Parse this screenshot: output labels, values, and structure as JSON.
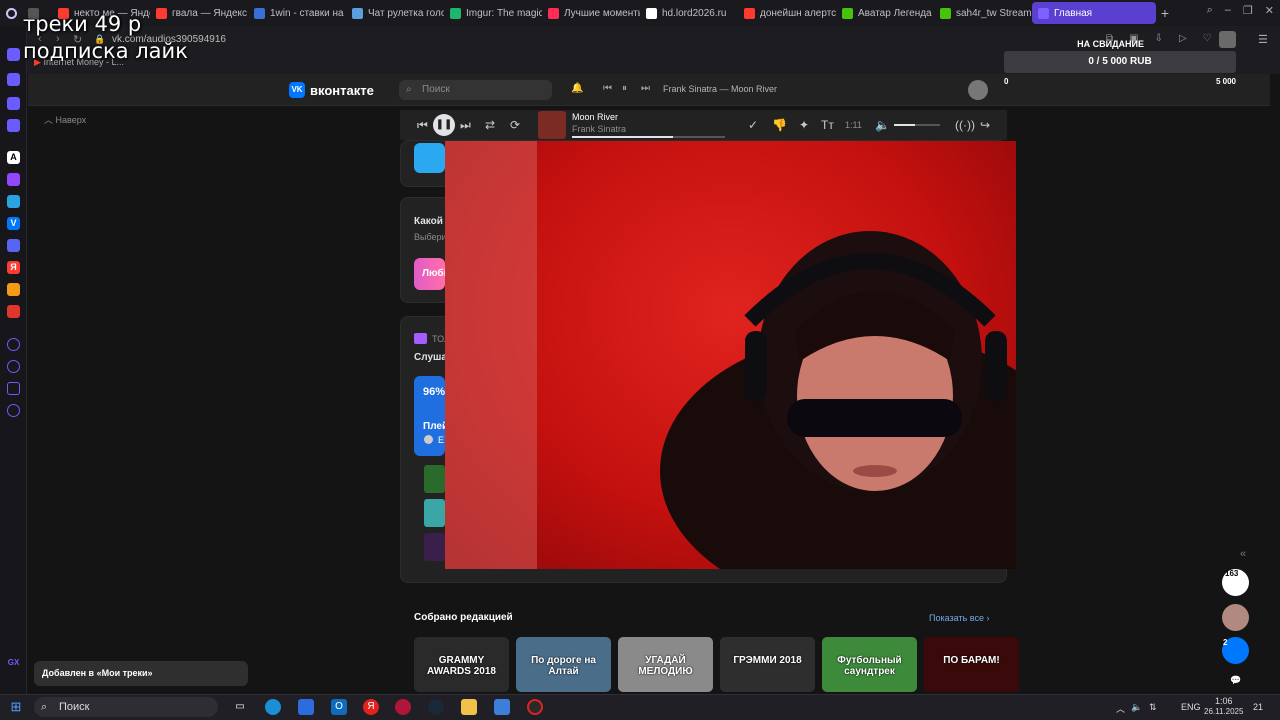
{
  "browser": {
    "tabs": [
      {
        "label": "некто ме — Янде",
        "color": "#ff3b30"
      },
      {
        "label": "гвала — Яндекс",
        "color": "#ff3b30"
      },
      {
        "label": "1win - ставки на",
        "color": "#3a6fd8"
      },
      {
        "label": "Чат рулетка голо",
        "color": "#5aa0e0"
      },
      {
        "label": "Imgur: The magic",
        "color": "#1bb76e"
      },
      {
        "label": "Лучшие моменты",
        "color": "#ff2d55"
      },
      {
        "label": "hd.lord2026.ru",
        "color": "#ffffff"
      },
      {
        "label": "донейшн алертс",
        "color": "#ff3b30"
      },
      {
        "label": "Аватар Легенда",
        "color": "#45c40a"
      },
      {
        "label": "sah4r_tw Stream",
        "color": "#45c40a"
      },
      {
        "label": "Главная",
        "color": "#7b61ff",
        "active": true
      }
    ],
    "new_tab": "+",
    "url": "vk.com/audios390594916",
    "bookmark": "Internet Money - L..."
  },
  "overlay": {
    "line1": "треки 49 р",
    "line2": "подписка лайк"
  },
  "donation": {
    "title": "НА СВИДАНИЕ",
    "progress": "0 / 5 000 RUB",
    "min": "0",
    "max": "5 000"
  },
  "vk": {
    "logo": "вконтакте",
    "search_placeholder": "Поиск",
    "header_track": "Frank Sinatra — Moon River",
    "back_to_top": "Наверх",
    "player": {
      "title": "Moon River",
      "artist": "Frank Sinatra",
      "time": "1:11",
      "progress_fraction": 0.66,
      "volume_fraction": 0.45
    },
    "card2_title": "Какой",
    "card2_sub": "Выбери",
    "card2_btn": "Любі",
    "card3_tag": "ТОЛ",
    "card3_title": "Слуша",
    "card3_pct": "96%",
    "card3_playlist": "Плей",
    "card3_author": "Е",
    "collection_title": "Собрано редакцией",
    "collection_more": "Показать все",
    "tiles": [
      {
        "label": "GRAMMY AWARDS 2018",
        "bg": "#2a2a2a"
      },
      {
        "label": "По дороге на Алтай",
        "bg": "#4a6d8a"
      },
      {
        "label": "УГАДАЙ МЕЛОДИЮ",
        "bg": "#8a8a8a"
      },
      {
        "label": "ГРЭММИ 2018",
        "bg": "#2e2e2e"
      },
      {
        "label": "Футбольный саундтрек",
        "bg": "#3c8a3a"
      },
      {
        "label": "ПО БАРАМ!",
        "bg": "#3a0a0a"
      }
    ],
    "toast": "Добавлен в «Мои треки»",
    "side_counter_1": "163",
    "side_counter_2": "2"
  },
  "taskbar": {
    "search": "Поиск",
    "lang": "ENG",
    "time": "1:06",
    "date": "26.11.2025",
    "notif_count": "21"
  },
  "colors": {
    "accent": "#5a3fd1",
    "vk_blue": "#0077ff",
    "cam_red": "#d11a17"
  }
}
